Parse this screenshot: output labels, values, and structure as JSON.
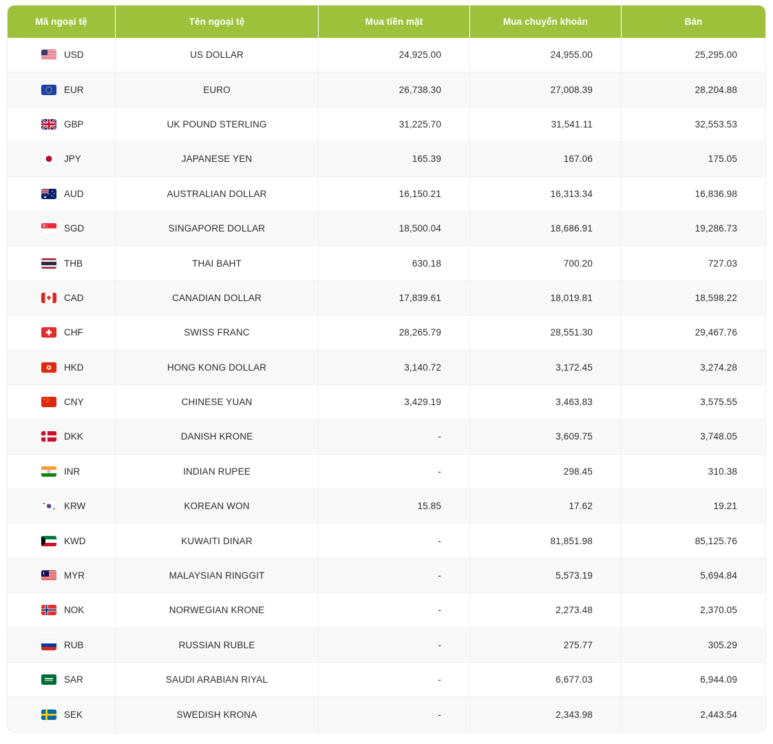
{
  "table": {
    "headers": {
      "code": "Mã ngoại tệ",
      "name": "Tên ngoại tệ",
      "buy_cash": "Mua tiền mặt",
      "buy_transfer": "Mua chuyển khoản",
      "sell": "Bán"
    },
    "accent_color": "#9ec13c",
    "header_text_color": "#ffffff",
    "row_alt_color": "#f8f8f8",
    "rows": [
      {
        "flag": "flag-us-icon",
        "code": "USD",
        "name": "US DOLLAR",
        "buy_cash": "24,925.00",
        "buy_transfer": "24,955.00",
        "sell": "25,295.00"
      },
      {
        "flag": "flag-eu-icon",
        "code": "EUR",
        "name": "EURO",
        "buy_cash": "26,738.30",
        "buy_transfer": "27,008.39",
        "sell": "28,204.88"
      },
      {
        "flag": "flag-gb-icon",
        "code": "GBP",
        "name": "UK POUND STERLING",
        "buy_cash": "31,225.70",
        "buy_transfer": "31,541.11",
        "sell": "32,553.53"
      },
      {
        "flag": "flag-jp-icon",
        "code": "JPY",
        "name": "JAPANESE YEN",
        "buy_cash": "165.39",
        "buy_transfer": "167.06",
        "sell": "175.05"
      },
      {
        "flag": "flag-au-icon",
        "code": "AUD",
        "name": "AUSTRALIAN DOLLAR",
        "buy_cash": "16,150.21",
        "buy_transfer": "16,313.34",
        "sell": "16,836.98"
      },
      {
        "flag": "flag-sg-icon",
        "code": "SGD",
        "name": "SINGAPORE DOLLAR",
        "buy_cash": "18,500.04",
        "buy_transfer": "18,686.91",
        "sell": "19,286.73"
      },
      {
        "flag": "flag-th-icon",
        "code": "THB",
        "name": "THAI BAHT",
        "buy_cash": "630.18",
        "buy_transfer": "700.20",
        "sell": "727.03"
      },
      {
        "flag": "flag-ca-icon",
        "code": "CAD",
        "name": "CANADIAN DOLLAR",
        "buy_cash": "17,839.61",
        "buy_transfer": "18,019.81",
        "sell": "18,598.22"
      },
      {
        "flag": "flag-ch-icon",
        "code": "CHF",
        "name": "SWISS FRANC",
        "buy_cash": "28,265.79",
        "buy_transfer": "28,551.30",
        "sell": "29,467.76"
      },
      {
        "flag": "flag-hk-icon",
        "code": "HKD",
        "name": "HONG KONG DOLLAR",
        "buy_cash": "3,140.72",
        "buy_transfer": "3,172.45",
        "sell": "3,274.28"
      },
      {
        "flag": "flag-cn-icon",
        "code": "CNY",
        "name": "CHINESE YUAN",
        "buy_cash": "3,429.19",
        "buy_transfer": "3,463.83",
        "sell": "3,575.55"
      },
      {
        "flag": "flag-dk-icon",
        "code": "DKK",
        "name": "DANISH KRONE",
        "buy_cash": "-",
        "buy_transfer": "3,609.75",
        "sell": "3,748.05"
      },
      {
        "flag": "flag-in-icon",
        "code": "INR",
        "name": "INDIAN RUPEE",
        "buy_cash": "-",
        "buy_transfer": "298.45",
        "sell": "310.38"
      },
      {
        "flag": "flag-kr-icon",
        "code": "KRW",
        "name": "KOREAN WON",
        "buy_cash": "15.85",
        "buy_transfer": "17.62",
        "sell": "19.21"
      },
      {
        "flag": "flag-kw-icon",
        "code": "KWD",
        "name": "KUWAITI DINAR",
        "buy_cash": "-",
        "buy_transfer": "81,851.98",
        "sell": "85,125.76"
      },
      {
        "flag": "flag-my-icon",
        "code": "MYR",
        "name": "MALAYSIAN RINGGIT",
        "buy_cash": "-",
        "buy_transfer": "5,573.19",
        "sell": "5,694.84"
      },
      {
        "flag": "flag-no-icon",
        "code": "NOK",
        "name": "NORWEGIAN KRONE",
        "buy_cash": "-",
        "buy_transfer": "2,273.48",
        "sell": "2,370.05"
      },
      {
        "flag": "flag-ru-icon",
        "code": "RUB",
        "name": "RUSSIAN RUBLE",
        "buy_cash": "-",
        "buy_transfer": "275.77",
        "sell": "305.29"
      },
      {
        "flag": "flag-sa-icon",
        "code": "SAR",
        "name": "SAUDI ARABIAN RIYAL",
        "buy_cash": "-",
        "buy_transfer": "6,677.03",
        "sell": "6,944.09"
      },
      {
        "flag": "flag-se-icon",
        "code": "SEK",
        "name": "SWEDISH KRONA",
        "buy_cash": "-",
        "buy_transfer": "2,343.98",
        "sell": "2,443.54"
      }
    ]
  }
}
